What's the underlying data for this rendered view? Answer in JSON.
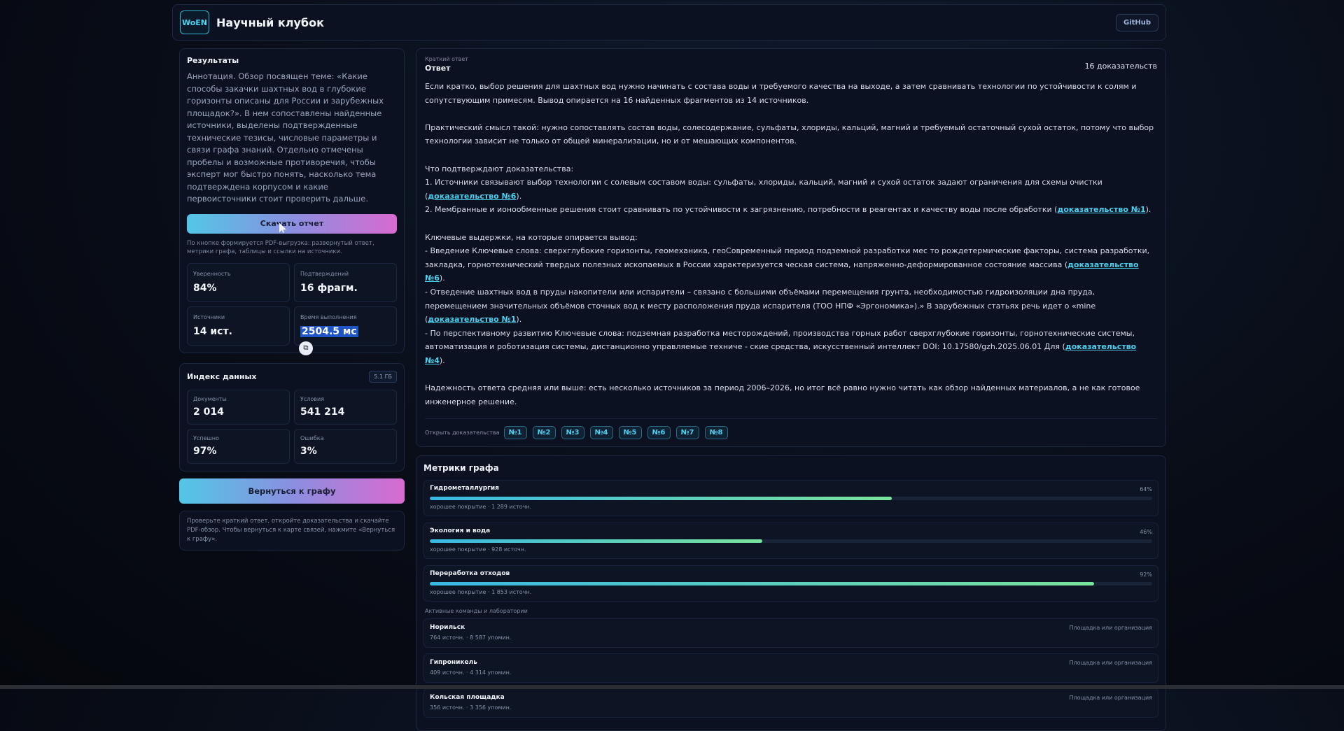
{
  "header": {
    "logo": "WoEN",
    "title": "Научный клубок",
    "github": "GitHub"
  },
  "results": {
    "title": "Результаты",
    "annotation": "Аннотация. Обзор посвящен теме: «Какие способы закачки шахтных вод в глубокие горизонты описаны для России и зарубежных площадок?». В нем сопоставлены найденные источники, выделены подтвержденные технические тезисы, числовые параметры и связи графа знаний. Отдельно отмечены пробелы и возможные противоречия, чтобы эксперт мог быстро понять, насколько тема подтверждена корпусом и какие первоисточники стоит проверить дальше.",
    "download_label": "Скачать отчет",
    "download_note": "По кнопке формируется PDF-выгрузка: развернутый ответ, метрики графа, таблицы и ссылки на источники.",
    "stats": [
      {
        "label": "Уверенность",
        "value": "84%"
      },
      {
        "label": "Подтверждений",
        "value": "16 фрагм."
      },
      {
        "label": "Источники",
        "value": "14 ист."
      },
      {
        "label": "Время выполнения",
        "value": "2504.5 мс"
      }
    ]
  },
  "index": {
    "title": "Индекс данных",
    "size": "5.1 ГБ",
    "stats": [
      {
        "label": "Документы",
        "value": "2 014"
      },
      {
        "label": "Условия",
        "value": "541 214"
      },
      {
        "label": "Успешно",
        "value": "97%"
      },
      {
        "label": "Ошибка",
        "value": "3%"
      }
    ]
  },
  "back_label": "Вернуться к графу",
  "hint": "Проверьте краткий ответ, откройте доказательства и скачайте PDF-обзор. Чтобы вернуться к карте связей, нажмите «Вернуться к графу».",
  "answer": {
    "small": "Краткий ответ",
    "title": "Ответ",
    "count": "16 доказательств",
    "p1": "Если кратко, выбор решения для шахтных вод нужно начинать с состава воды и требуемого качества на выходе, а затем сравнивать технологии по устойчивости к солям и сопутствующим примесям. Вывод опирается на 16 найденных фрагментов из 14 источников.",
    "p2": "Практический смысл такой: нужно сопоставлять состав воды, солесодержание, сульфаты, хлориды, кальций, магний и требуемый остаточный сухой остаток, потому что выбор технологии зависит не только от общей минерализации, но и от мешающих компонентов.",
    "p3_head": "Что подтверждают доказательства:",
    "p3_l1": "1. Источники связывают выбор технологии с солевым составом воды: сульфаты, хлориды, кальций, магний и сухой остаток задают ограничения для схемы очистки (",
    "p3_l1_ev": "доказательство №6",
    "p3_l1_end": ").",
    "p3_l2": "2. Мембранные и ионообменные решения стоит сравнивать по устойчивости к загрязнению, потребности в реагентах и качеству воды после обработки (",
    "p3_l2_ev": "доказательство №1",
    "p3_l2_end": ").",
    "p4_head": "Ключевые выдержки, на которые опирается вывод:",
    "p4_l1": "- Введение Ключевые слова: сверхглубокие горизонты, геомеханика, геоСовременный период подземной разработки мес то рождетермические факторы, система разработки, закладка, горнотехнический твердых полезных ископаемых в России характеризуется ческая система, напряженно-деформированное состояние массива (",
    "p4_l1_ev": "доказательство №6",
    "p4_l1_end": ").",
    "p4_l2": "- Отведение шахтных вод в пруды накопители или испарители – связано с большими объёмами перемещения грунта, необходимостью гидроизоляции дна пруда, перемещением значительных объёмов сточных вод к месту расположения пруда испарителя (ТОО НПФ «Эргономика»).» В зарубежных статьях речь идет о «mine (",
    "p4_l2_ev": "доказательство №1",
    "p4_l2_end": ").",
    "p4_l3": "- По перспективному развитию Ключевые слова: подземная разработка месторождений, производства горных работ сверхглубокие горизонты, горнотехнические системы, автоматизация и роботизация системы, дистанционно управляемые техниче - ские средства, искусственный интеллект DOI: 10.17580/gzh.2025.06.01 Для (",
    "p4_l3_ev": "доказательство №4",
    "p4_l3_end": ").",
    "p5": "Надежность ответа средняя или выше: есть несколько источников за период 2006–2026, но итог всё равно нужно читать как обзор найденных материалов, а не как готовое инженерное решение.",
    "evidence_label": "Открыть доказательства",
    "evidence": [
      "№1",
      "№2",
      "№3",
      "№4",
      "№5",
      "№6",
      "№7",
      "№8"
    ]
  },
  "metrics": {
    "title": "Метрики графа",
    "bars": [
      {
        "name": "Гидрометаллургия",
        "pct": "64%",
        "value": 64,
        "sub": "хорошее покрытие · 1 289 источн."
      },
      {
        "name": "Экология и вода",
        "pct": "46%",
        "value": 46,
        "sub": "хорошее покрытие · 928 источн."
      },
      {
        "name": "Переработка отходов",
        "pct": "92%",
        "value": 92,
        "sub": "хорошее покрытие · 1 853 источн."
      }
    ],
    "teams_label": "Активные команды и лаборатории",
    "teams": [
      {
        "name": "Норильск",
        "sub": "764 источн. · 8 587 упомин.",
        "tag": "Площадка или организация"
      },
      {
        "name": "Гипроникель",
        "sub": "409 источн. · 4 314 упомин.",
        "tag": "Площадка или организация"
      },
      {
        "name": "Кольская площадка",
        "sub": "356 источн. · 3 356 упомин.",
        "tag": "Площадка или организация"
      }
    ]
  }
}
